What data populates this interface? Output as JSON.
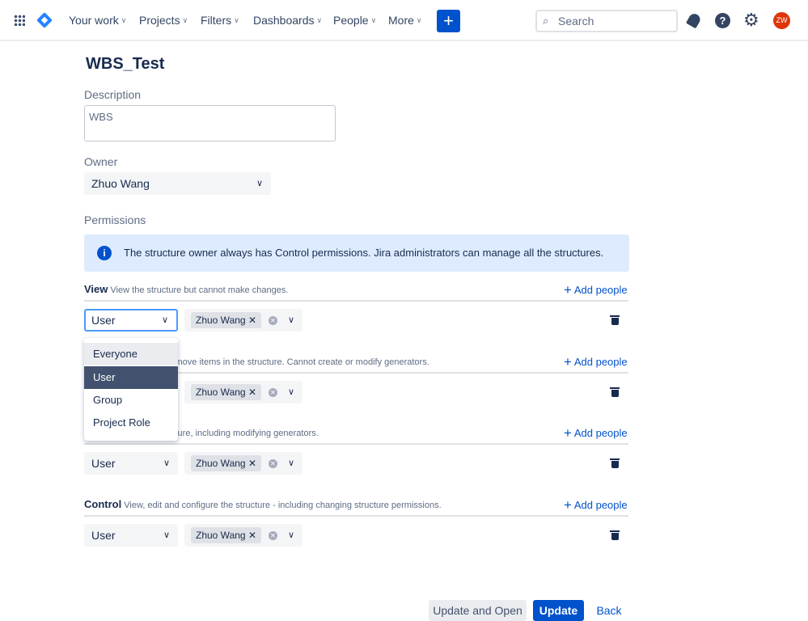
{
  "topbar": {
    "nav": [
      "Your work",
      "Projects",
      "Filters",
      "Dashboards",
      "People",
      "More"
    ],
    "search_placeholder": "Search",
    "avatar": "ZW"
  },
  "page": {
    "title": "WBS_Test",
    "description_label": "Description",
    "description_value": "WBS",
    "owner_label": "Owner",
    "owner_value": "Zhuo Wang",
    "permissions_label": "Permissions",
    "info": "The structure owner always has Control permissions. Jira administrators can manage all the structures."
  },
  "sections": [
    {
      "title": "View",
      "desc": "View the structure but cannot make changes.",
      "type": "User",
      "person": "Zhuo Wang",
      "add": "Add people"
    },
    {
      "title": "",
      "desc": "; rearrange, add and remove items in the structure. Cannot create or modify generators.",
      "type": "User",
      "person": "Zhuo Wang",
      "add": "Add people"
    },
    {
      "title": "",
      "desc": "edit access to the structure, including modifying generators.",
      "type": "User",
      "person": "Zhuo Wang",
      "add": "Add people"
    },
    {
      "title": "Control",
      "desc": "View, edit and configure the structure - including changing structure permissions.",
      "type": "User",
      "person": "Zhuo Wang",
      "add": "Add people"
    }
  ],
  "dropdown": {
    "options": [
      "Everyone",
      "User",
      "Group",
      "Project Role"
    ],
    "selected": "User",
    "hovered": "Everyone"
  },
  "footer": {
    "update_open": "Update and Open",
    "update": "Update",
    "back": "Back"
  },
  "colors": {
    "primary": "#0052cc",
    "info_bg": "#deebff",
    "selected": "#42526e",
    "avatar": "#de350b"
  }
}
